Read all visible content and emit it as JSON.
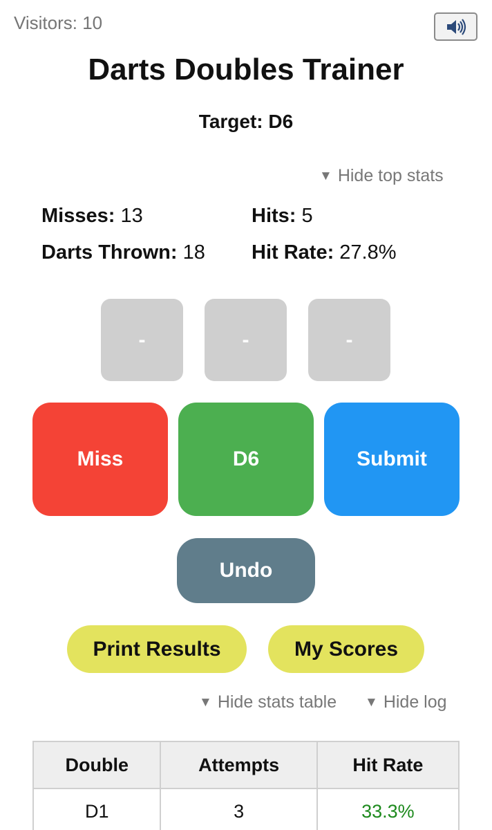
{
  "header": {
    "visitors": "Visitors: 10",
    "sound_icon": "speaker-icon"
  },
  "title": "Darts Doubles Trainer",
  "target": {
    "label": "Target:",
    "value": "D6"
  },
  "toggles": {
    "hide_top_stats": "Hide top stats",
    "hide_stats_table": "Hide stats table",
    "hide_log": "Hide log",
    "arrow": "▼"
  },
  "stats": {
    "misses_label": "Misses:",
    "misses_value": "13",
    "hits_label": "Hits:",
    "hits_value": "5",
    "thrown_label": "Darts Thrown:",
    "thrown_value": "18",
    "rate_label": "Hit Rate:",
    "rate_value": "27.8%"
  },
  "dart_slots": [
    "-",
    "-",
    "-"
  ],
  "buttons": {
    "miss": "Miss",
    "hit": "D6",
    "submit": "Submit",
    "undo": "Undo",
    "print": "Print Results",
    "scores": "My Scores"
  },
  "table": {
    "headers": [
      "Double",
      "Attempts",
      "Hit Rate"
    ],
    "rows": [
      {
        "double": "D1",
        "attempts": "3",
        "rate": "33.3%"
      }
    ]
  },
  "colors": {
    "miss": "#f44336",
    "hit": "#4caf50",
    "submit": "#2196f3",
    "undo": "#607d8b",
    "pill": "#e3e35e",
    "good_rate": "#1e8a1e"
  }
}
